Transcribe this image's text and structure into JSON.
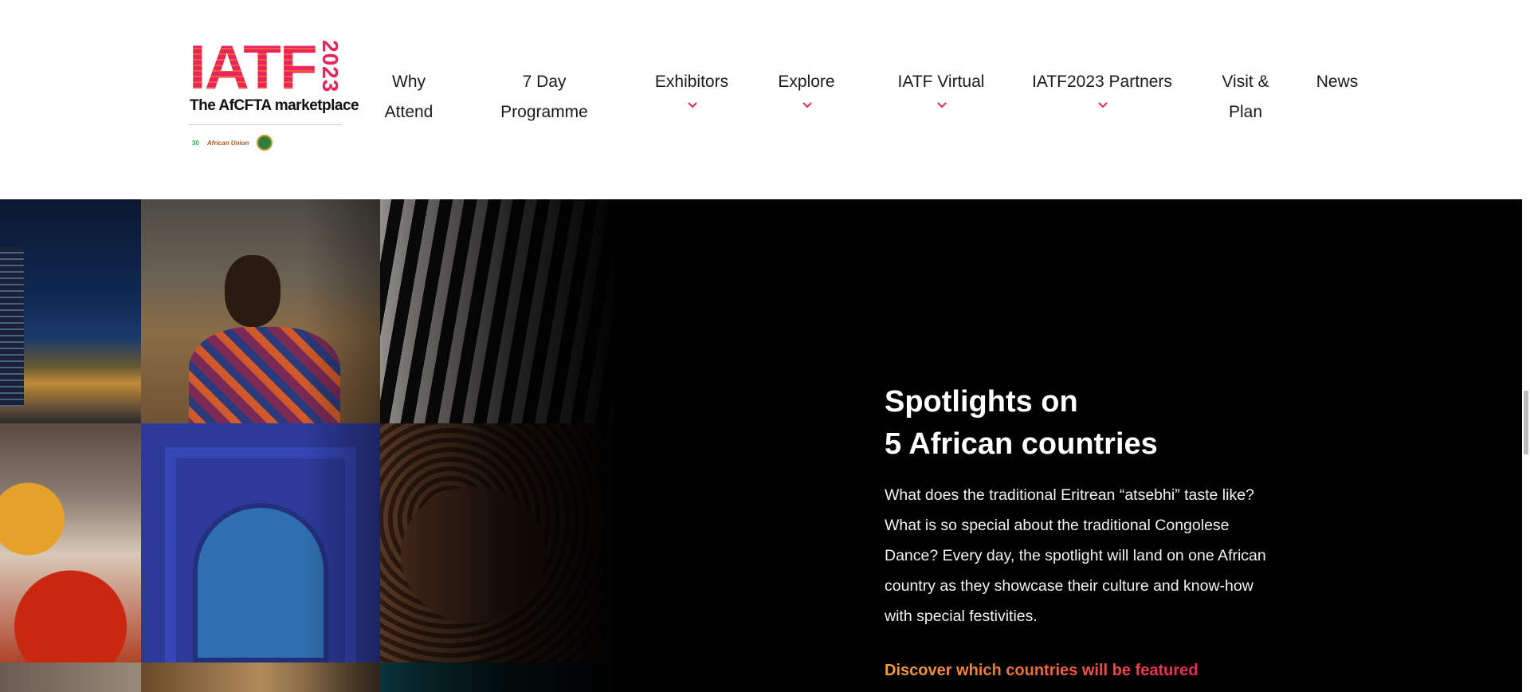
{
  "logo": {
    "brand": "IATF",
    "year": "2023",
    "tagline": "The AfCFTA marketplace",
    "badge_1": "30",
    "badge_2": "African Union"
  },
  "nav": {
    "items": [
      {
        "line1": "Why",
        "line2": "Attend",
        "dropdown": false
      },
      {
        "line1": "7 Day",
        "line2": "Programme",
        "dropdown": false
      },
      {
        "line1": "Exhibitors",
        "line2": "",
        "dropdown": true
      },
      {
        "line1": "Explore",
        "line2": "",
        "dropdown": true
      },
      {
        "line1": "IATF Virtual",
        "line2": "",
        "dropdown": true
      },
      {
        "line1": "IATF2023 Partners",
        "line2": "",
        "dropdown": true
      },
      {
        "line1": "Visit &",
        "line2": "Plan",
        "dropdown": false
      },
      {
        "line1": "News",
        "line2": "",
        "dropdown": false
      }
    ]
  },
  "hero": {
    "title_line1": "Spotlights on",
    "title_line2": "5 African countries",
    "description": "What does the traditional Eritrean “atsebhi” taste like? What is so special about the traditional Congolese Dance? Every day, the spotlight will land on one African country as they showcase their culture and know-how with special festivities.",
    "cta": "Discover which countries will be featured"
  },
  "colors": {
    "accent_pink": "#e8245a",
    "accent_orange": "#f5a03a",
    "hero_bg": "#000000"
  },
  "icons": {
    "dropdown": "chevron-down-icon"
  }
}
